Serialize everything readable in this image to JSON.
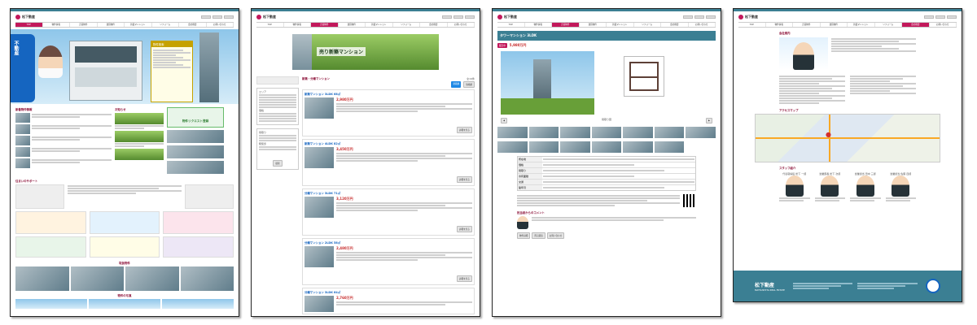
{
  "brand": {
    "name": "松下動産",
    "accent": "#c2185b",
    "footer_color": "#3b7f93",
    "link_color": "#1e88e5"
  },
  "nav_items": [
    "TOP",
    "物件情報",
    "売買物件",
    "賃貸物件",
    "新築マンション",
    "リフォーム",
    "会社概要",
    "お問い合わせ"
  ],
  "panel1": {
    "hero_sign": "不動産",
    "sidebar_title": "物件検索",
    "section_titles": [
      "新着物件情報",
      "お知らせ"
    ],
    "banner": "物件リクエスト登録",
    "mid_heading": "住まいのサポート",
    "bottom_heading": "取扱物件",
    "footer_heading": "物件の写真"
  },
  "panel2": {
    "banner_title": "売り新築マンション",
    "list_heading": "新築・分譲マンション",
    "result_count": "全19件",
    "sort_labels": [
      "新着順",
      "価格順"
    ],
    "listings": [
      {
        "title": "新築マンション 3LDK 68㎡",
        "price": "2,980万円",
        "btn": "詳細を見る"
      },
      {
        "title": "新築マンション 4LDK 82㎡",
        "price": "3,450万円",
        "btn": "詳細を見る"
      },
      {
        "title": "分譲マンション 3LDK 71㎡",
        "price": "3,120万円",
        "btn": "詳細を見る"
      },
      {
        "title": "分譲マンション 2LDK 58㎡",
        "price": "2,480万円",
        "btn": "詳細を見る"
      },
      {
        "title": "分譲マンション 3LDK 64㎡",
        "price": "2,760万円",
        "btn": "詳細を見る"
      }
    ],
    "filters": [
      "エリア",
      "価格",
      "間取り",
      "駅徒歩"
    ],
    "search_btn": "検索"
  },
  "panel3": {
    "title_bar": "タワーマンション 3LDK",
    "badge": "販売中",
    "price": "5,980万円",
    "floorplan_label": "間取り図",
    "table_labels": [
      "所在地",
      "価格",
      "間取り",
      "専有面積",
      "交通",
      "築年月"
    ],
    "staff_heading": "担当者からのコメント",
    "tabs": [
      "物件詳細",
      "周辺環境",
      "お問い合わせ"
    ]
  },
  "panel4": {
    "company_heading": "会社案内",
    "access_heading": "アクセスマップ",
    "staff_heading": "スタッフ紹介",
    "staff": [
      {
        "role": "代表取締役",
        "name": "松下 一郎"
      },
      {
        "role": "営業部長",
        "name": "松下 次郎"
      },
      {
        "role": "営業担当",
        "name": "田中 三郎"
      },
      {
        "role": "営業担当",
        "name": "佐藤 四郎"
      }
    ],
    "footer_company": "松下動産",
    "footer_sub": "MATSUSHITA REAL ESTATE"
  }
}
